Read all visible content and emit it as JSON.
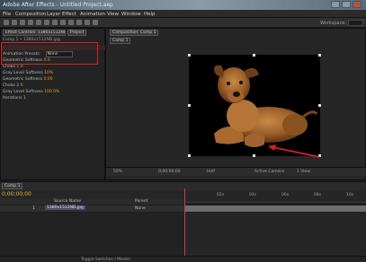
{
  "window": {
    "title": "Adobe After Effects - Untitled Project.aep"
  },
  "menu": [
    "File",
    "Composition",
    "Layer",
    "Effect",
    "Animation",
    "View",
    "Window",
    "Help"
  ],
  "toolbar": {
    "workspace_label": "Workspace:"
  },
  "left_panel": {
    "tabs": [
      "Effect Controls: 1380x1512ND.jpg",
      "Project"
    ],
    "breadcrumb": "Comp 1 • 1380x1512ND.jpg",
    "rows": [
      {
        "label": "Animation Presets:",
        "value": "None"
      },
      {
        "label": "Geometric Softness",
        "value": "0.0"
      },
      {
        "label": "Choke 1",
        "value": "0"
      },
      {
        "label": "Gray Level Softness",
        "value": "10%"
      },
      {
        "label": "Geometric Softness",
        "value": "0.00"
      },
      {
        "label": "Choke 2",
        "value": "0"
      },
      {
        "label": "Gray Level Softness",
        "value": "100.0%"
      },
      {
        "label": "Iterations",
        "value": "1"
      }
    ]
  },
  "comp_panel": {
    "tab_label": "Composition: Comp 1",
    "sub_tab": "Comp 1",
    "zoom": "50%",
    "timecode": "0;00;00;00",
    "resolution": "Half",
    "view": "Active Camera",
    "views": "1 View"
  },
  "timeline": {
    "timecode": "0;00;00;00",
    "comp_tab": "Comp 1",
    "ruler_ticks": [
      "00s",
      "02s",
      "04s",
      "06s",
      "08s",
      "10s"
    ],
    "columns": [
      "Source Name",
      "Parent"
    ],
    "layer": {
      "index": "1",
      "name": "1380x1512ND.jpg",
      "parent": "None"
    }
  },
  "status": {
    "text": "Toggle Switches / Modes"
  }
}
